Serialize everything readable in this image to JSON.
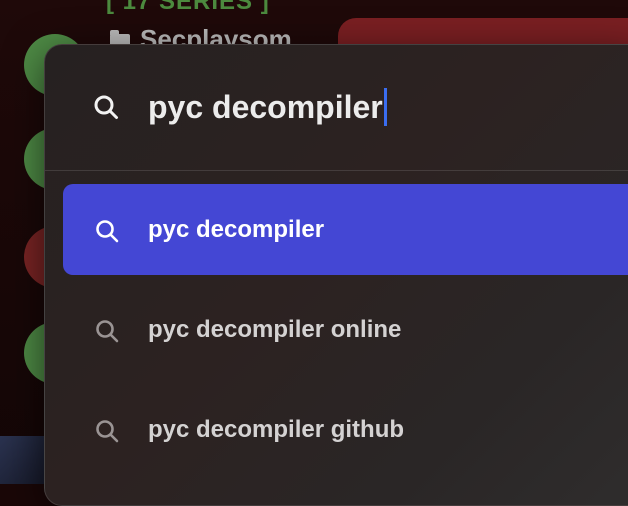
{
  "background": {
    "header_text": "[ 17 SERIES ]",
    "folder_label": "Secplaysom",
    "dot_colors": [
      "#4e8a45",
      "#4e8a45",
      "#7a2424",
      "#4e8a45"
    ]
  },
  "search": {
    "query": "pyc decompiler",
    "icon": "search-icon",
    "caret_color": "#3a6df0"
  },
  "suggestions": [
    {
      "label": "pyc decompiler",
      "icon": "search-icon",
      "selected": true
    },
    {
      "label": "pyc decompiler online",
      "icon": "search-icon",
      "selected": false
    },
    {
      "label": "pyc decompiler github",
      "icon": "search-icon",
      "selected": false
    }
  ],
  "colors": {
    "selected_bg": "#4447d4",
    "panel_bg": "#2a2424",
    "text": "#d4d2d2"
  }
}
